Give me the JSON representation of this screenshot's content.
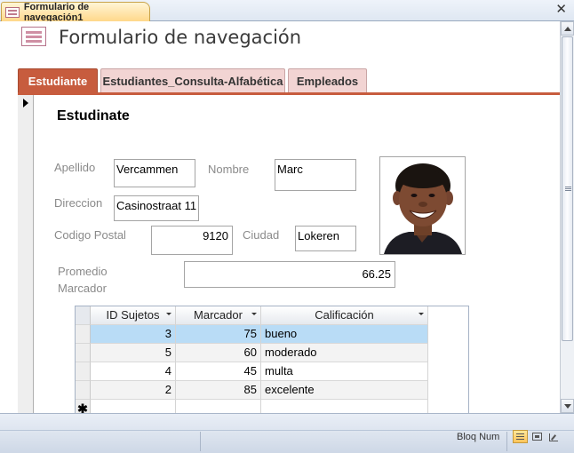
{
  "document_tab": {
    "label": "Formulario de navegación1"
  },
  "header": {
    "title": "Formulario de navegación"
  },
  "nav_tabs": [
    {
      "label": "Estudiante"
    },
    {
      "label": "Estudiantes_Consulta-Alfabética"
    },
    {
      "label": "Empleados"
    }
  ],
  "subform": {
    "title": "Estudinate",
    "fields": {
      "apellido": {
        "label": "Apellido",
        "value": "Vercammen"
      },
      "nombre": {
        "label": "Nombre",
        "value": "Marc"
      },
      "direccion": {
        "label": "Direccion",
        "value": "Casinostraat 11"
      },
      "codigo_postal": {
        "label": "Codigo Postal",
        "value": "9120"
      },
      "ciudad": {
        "label": "Ciudad",
        "value": "Lokeren"
      },
      "promedio": {
        "label_line1": "Promedio",
        "label_line2": "Marcador",
        "value": "66.25"
      }
    }
  },
  "grid": {
    "columns": [
      "ID Sujetos",
      "Marcador",
      "Calificación"
    ],
    "rows": [
      {
        "id": "3",
        "marcador": "75",
        "calificacion": "bueno"
      },
      {
        "id": "5",
        "marcador": "60",
        "calificacion": "moderado"
      },
      {
        "id": "4",
        "marcador": "45",
        "calificacion": "multa"
      },
      {
        "id": "2",
        "marcador": "85",
        "calificacion": "excelente"
      }
    ],
    "new_row_symbol": "✱"
  },
  "status": {
    "bloq_num": "Bloq Num"
  },
  "icons": {
    "close": "close-icon",
    "record_selector": "record-pointer-icon",
    "form_view": "form-view-icon",
    "layout_view": "layout-view-icon",
    "design_view": "design-view-icon"
  },
  "colors": {
    "accent": "#c75c3e",
    "tab_inactive": "#f2d4d3",
    "selected_row": "#b9dcf6"
  }
}
